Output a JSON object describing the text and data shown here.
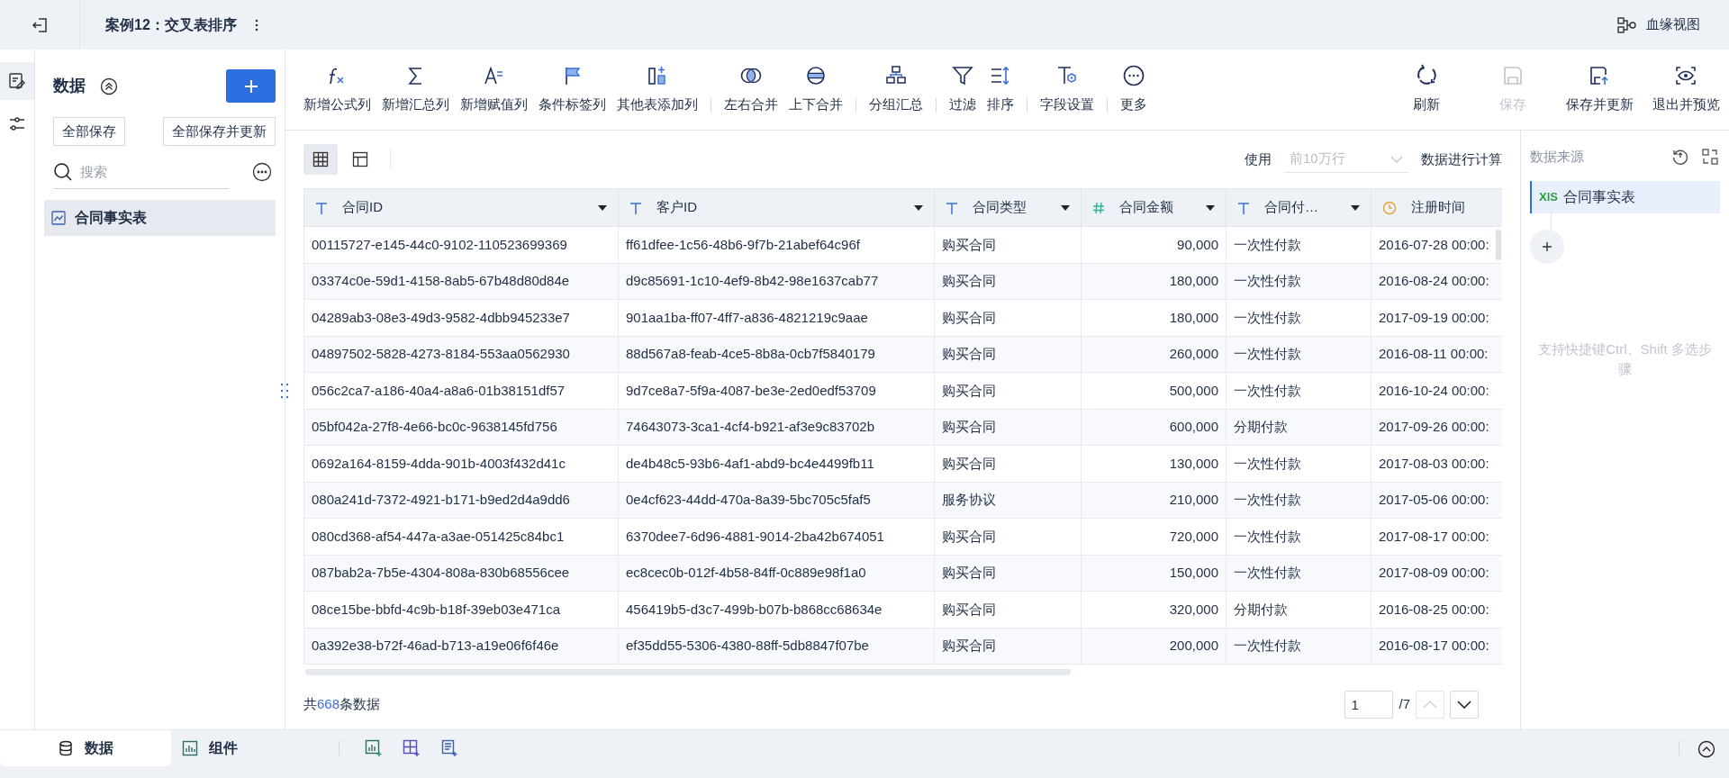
{
  "top_bar": {
    "title": "案例12：交叉表排序",
    "lineage_button": "血缘视图"
  },
  "left_rail": [
    {
      "selected": true
    },
    {
      "selected": false
    }
  ],
  "left_panel": {
    "title": "数据",
    "save_all": "全部保存",
    "save_all_update": "全部保存并更新",
    "search": {
      "placeholder": "搜索"
    },
    "items": [
      {
        "label": "合同事实表",
        "selected": true
      }
    ]
  },
  "toolbar": {
    "groups": [
      [
        {
          "label": "新增公式列"
        },
        {
          "label": "新增汇总列"
        },
        {
          "label": "新增赋值列"
        },
        {
          "label": "条件标签列"
        },
        {
          "label": "其他表添加列"
        }
      ],
      [
        {
          "label": "左右合并"
        },
        {
          "label": "上下合并"
        }
      ],
      [
        {
          "label": "分组汇总"
        }
      ],
      [
        {
          "label": "过滤"
        },
        {
          "label": "排序"
        }
      ],
      [
        {
          "label": "字段设置"
        }
      ],
      [
        {
          "label": "更多"
        }
      ]
    ],
    "actions": [
      {
        "label": "刷新",
        "disabled": false
      },
      {
        "label": "保存",
        "disabled": true
      },
      {
        "label": "保存并更新",
        "disabled": false
      },
      {
        "label": "退出并预览",
        "disabled": false
      }
    ]
  },
  "view_toggle": [
    {
      "selected": true
    },
    {
      "selected": false
    }
  ],
  "row_limit": {
    "prefix": "使用",
    "select": {
      "placeholder": "前10万行"
    },
    "suffix": "数据进行计算"
  },
  "table": {
    "columns": [
      {
        "label": "合同ID",
        "kind": "text"
      },
      {
        "label": "客户ID",
        "kind": "text"
      },
      {
        "label": "合同类型",
        "kind": "text"
      },
      {
        "label": "合同金额",
        "kind": "number"
      },
      {
        "label": "合同付…",
        "kind": "text"
      },
      {
        "label": "注册时间",
        "kind": "date"
      }
    ],
    "rows": [
      [
        "00115727-e145-44c0-9102-110523699369",
        "ff61dfee-1c56-48b6-9f7b-21abef64c96f",
        "购买合同",
        "90,000",
        "一次性付款",
        "2016-07-28 00:00:"
      ],
      [
        "03374c0e-59d1-4158-8ab5-67b48d80d84e",
        "d9c85691-1c10-4ef9-8b42-98e1637cab77",
        "购买合同",
        "180,000",
        "一次性付款",
        "2016-08-24 00:00:"
      ],
      [
        "04289ab3-08e3-49d3-9582-4dbb945233e7",
        "901aa1ba-ff07-4ff7-a836-4821219c9aae",
        "购买合同",
        "180,000",
        "一次性付款",
        "2017-09-19 00:00:"
      ],
      [
        "04897502-5828-4273-8184-553aa0562930",
        "88d567a8-feab-4ce5-8b8a-0cb7f5840179",
        "购买合同",
        "260,000",
        "一次性付款",
        "2016-08-11 00:00:"
      ],
      [
        "056c2ca7-a186-40a4-a8a6-01b38151df57",
        "9d7ce8a7-5f9a-4087-be3e-2ed0edf53709",
        "购买合同",
        "500,000",
        "一次性付款",
        "2016-10-24 00:00:"
      ],
      [
        "05bf042a-27f8-4e66-bc0c-9638145fd756",
        "74643073-3ca1-4cf4-b921-af3e9c83702b",
        "购买合同",
        "600,000",
        "分期付款",
        "2017-09-26 00:00:"
      ],
      [
        "0692a164-8159-4dda-901b-4003f432d41c",
        "de4b48c5-93b6-4af1-abd9-bc4e4499fb11",
        "购买合同",
        "130,000",
        "一次性付款",
        "2017-08-03 00:00:"
      ],
      [
        "080a241d-7372-4921-b171-b9ed2d4a9dd6",
        "0e4cf623-44dd-470a-8a39-5bc705c5faf5",
        "服务协议",
        "210,000",
        "一次性付款",
        "2017-05-06 00:00:"
      ],
      [
        "080cd368-af54-447a-a3ae-051425c84bc1",
        "6370dee7-6d96-4881-9014-2ba42b674051",
        "购买合同",
        "720,000",
        "一次性付款",
        "2017-08-17 00:00:"
      ],
      [
        "087bab2a-7b5e-4304-808a-830b68556cee",
        "ec8cec0b-012f-4b58-84ff-0c889e98f1a0",
        "购买合同",
        "150,000",
        "一次性付款",
        "2017-08-09 00:00:"
      ],
      [
        "08ce15be-bbfd-4c9b-b18f-39eb03e471ca",
        "456419b5-d3c7-499b-b07b-b868cc68634e",
        "购买合同",
        "320,000",
        "分期付款",
        "2016-08-25 00:00:"
      ],
      [
        "0a392e38-b72f-46ad-b713-a19e06f6f46e",
        "ef35dd55-5306-4380-88ff-5db8847f07be",
        "购买合同",
        "200,000",
        "一次性付款",
        "2016-08-17 00:00:"
      ]
    ]
  },
  "footer": {
    "total_prefix": "共",
    "total_count": "668",
    "total_suffix": "条数据",
    "page": "1",
    "page_total": "/7",
    "prev_disabled": true
  },
  "right_panel": {
    "title": "数据来源",
    "steps": [
      {
        "badge": "XlS",
        "label": "合同事实表",
        "selected": true
      }
    ],
    "hint": "支持快捷键Ctrl、Shift 多选步骤"
  },
  "bottom_bar": {
    "tabs": [
      {
        "label": "数据",
        "selected": true
      },
      {
        "label": "组件",
        "selected": false
      }
    ]
  }
}
